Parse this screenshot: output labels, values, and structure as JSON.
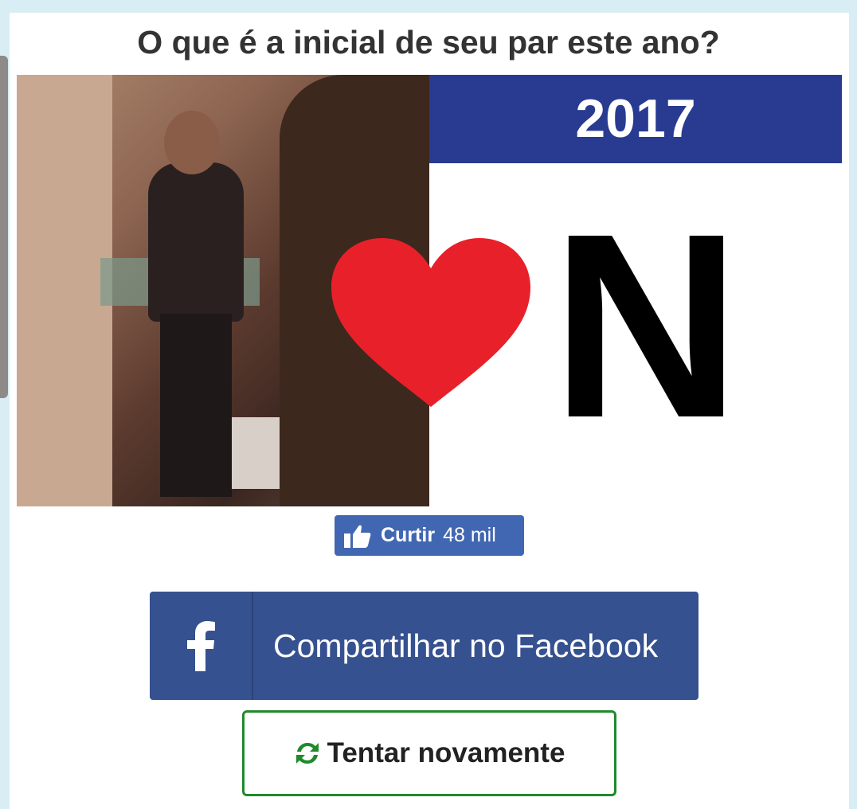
{
  "quiz": {
    "question": "O que é a inicial de seu par este ano?"
  },
  "result": {
    "year": "2017",
    "initial": "N"
  },
  "like": {
    "label": "Curtir",
    "count": "48 mil",
    "icon": "thumbs-up-icon"
  },
  "share": {
    "label": "Compartilhar no Facebook",
    "icon": "facebook-icon"
  },
  "retry": {
    "label": "Tentar novamente",
    "icon": "refresh-icon"
  },
  "colors": {
    "background": "#d9edf4",
    "year_bar": "#283b91",
    "heart": "#e8202a",
    "like_button": "#4267b2",
    "facebook_button": "#36518f",
    "retry_border": "#1f8a2c"
  }
}
